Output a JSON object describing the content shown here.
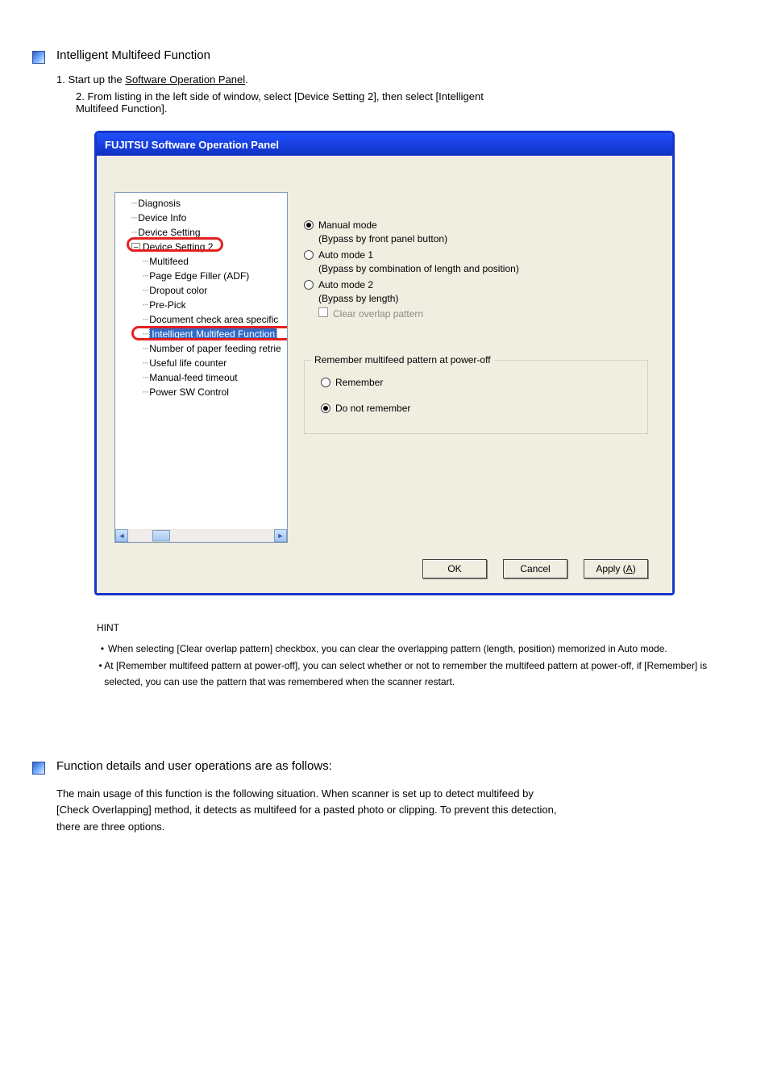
{
  "top": {
    "heading": "Intelligent Multifeed Function",
    "step1_prefix": "1. Start up the ",
    "step1_link": "Software Operation Panel",
    "step1_suffix": ".",
    "step2": "2. From listing in the left side of window, select [Device Setting 2], then select  [Intelligent \nMultifeed Function]. "
  },
  "dialog": {
    "title": "FUJITSU Software Operation Panel",
    "tree": {
      "diag": "Diagnosis",
      "dinfo": "Device Info",
      "dset": "Device Setting",
      "dset2": "Device Setting 2",
      "mf": "Multifeed",
      "pef": "Page Edge Filler (ADF)",
      "drop": "Dropout color",
      "pp": "Pre-Pick",
      "dca": "Document check area specific",
      "imf": "Intelligent Multifeed Function",
      "npr": "Number of paper feeding retrie",
      "ulc": "Useful life counter",
      "mft": "Manual-feed timeout",
      "psc": "Power SW Control"
    },
    "options": {
      "manual": "Manual mode",
      "manual_sub": "(Bypass by front panel button)",
      "auto1": "Auto mode 1",
      "auto1_sub": "(Bypass by combination of length and position)",
      "auto2": "Auto mode 2",
      "auto2_sub": "(Bypass by length)",
      "clear": "Clear overlap pattern"
    },
    "group": {
      "legend": "Remember multifeed pattern at power-off",
      "remember": "Remember",
      "notremember": "Do not remember"
    },
    "buttons": {
      "ok": "OK",
      "cancel": "Cancel",
      "apply": "Apply (",
      "apply_u": "A",
      "apply_end": ")"
    }
  },
  "hint": {
    "lead": "HINT",
    "item1": "When selecting [Clear overlap pattern] checkbox, you can clear the overlapping pattern (length, position) memorized in Auto mode.",
    "item2": "At [Remember multifeed pattern at power-off], you can select whether or not to remember the multifeed pattern at power-off, if [Remember] is selected, you can use the pattern that was remembered when the scanner restart."
  },
  "bottom": {
    "heading": "Function details and user operations are as follows:",
    "body": "The main usage of this function is the following situation. When scanner is set up to detect multifeed by \n[Check Overlapping] method, it detects as multifeed for a pasted photo or clipping. To prevent this detection, \nthere are three options."
  }
}
